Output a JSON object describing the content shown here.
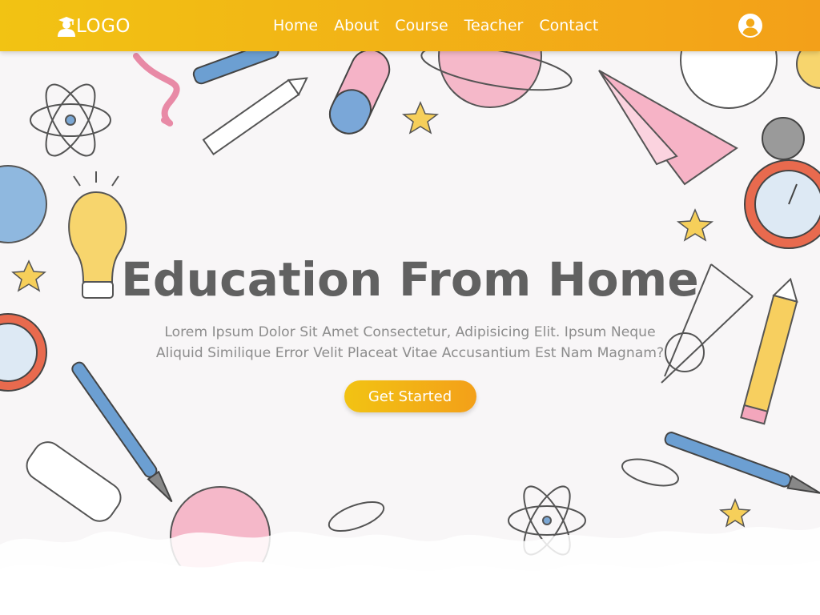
{
  "header": {
    "logo_text": "LOGO",
    "logo_icon": "graduate-icon",
    "nav": [
      {
        "label": "Home"
      },
      {
        "label": "About"
      },
      {
        "label": "Course"
      },
      {
        "label": "Teacher"
      },
      {
        "label": "Contact"
      }
    ],
    "account_icon": "user-circle-icon"
  },
  "hero": {
    "title": "Education From Home",
    "description_line1": "Lorem Ipsum Dolor Sit Amet Consectetur, Adipisicing Elit. Ipsum Neque",
    "description_line2": "Aliquid Similique Error Velit Placeat Vitae Accusantium Est Nam Magnam?",
    "cta_label": "Get Started"
  },
  "colors": {
    "header_gradient_start": "#f2c313",
    "header_gradient_end": "#f3a019",
    "title": "#616161",
    "text": "#8c8c8c",
    "background": "#f8f6f7"
  }
}
